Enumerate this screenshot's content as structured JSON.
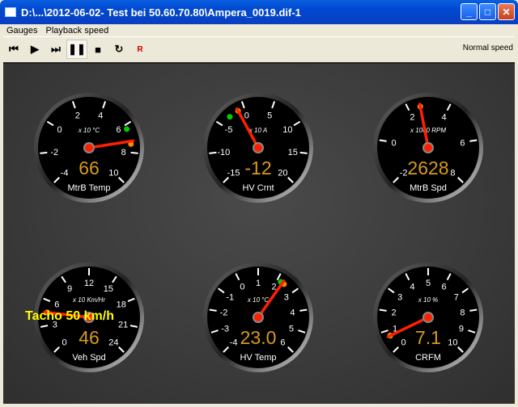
{
  "window": {
    "title": "D:\\...\\2012-06-02- Test bei 50.60.70.80\\Ampera_0019.dif-1"
  },
  "menu": [
    "Gauges",
    "Playback speed"
  ],
  "toolbar": {
    "buttons": [
      {
        "name": "skip-to-start-button",
        "glyph": "⏮"
      },
      {
        "name": "play-button",
        "glyph": "▶"
      },
      {
        "name": "skip-to-end-button",
        "glyph": "⏭"
      },
      {
        "name": "pause-button",
        "glyph": "❚❚",
        "pressed": true
      },
      {
        "name": "stop-button",
        "glyph": "■"
      },
      {
        "name": "loop-button",
        "glyph": "↻"
      },
      {
        "name": "reverse-button",
        "glyph": "R"
      }
    ],
    "speed_label": "Normal speed"
  },
  "colors": {
    "needle": "#ff2000",
    "readout": "#d89a1c",
    "min_marker": "#00cc00",
    "max_marker": "#ff8800",
    "status": "#ffff00"
  },
  "gauges": [
    {
      "label": "MtrB Temp",
      "unit": "x 10 °C",
      "readout": "66",
      "scale": [
        "-4",
        "-2",
        "0",
        "2",
        "4",
        "6",
        "8",
        "10"
      ],
      "needle": 7.2,
      "min_marker": 6.3,
      "max_marker": 7.4
    },
    {
      "label": "HV Crnt",
      "unit": "x 10 A",
      "readout": "-12",
      "scale": [
        "-15",
        "-10",
        "-5",
        "0",
        "5",
        "10",
        "15",
        "20"
      ],
      "needle": -1.2,
      "min_marker": -3,
      "max_marker": -1.2
    },
    {
      "label": "MtrB Spd",
      "unit": "x 1000 RPM",
      "readout": "2628",
      "scale": [
        "-2",
        "0",
        "2",
        "4",
        "6",
        "8"
      ],
      "needle": 2.6,
      "min_marker": 2.6,
      "max_marker": 2.6
    },
    {
      "label": "Veh Spd",
      "unit": "x 10 Km/Hr",
      "readout": "46",
      "scale": [
        "0",
        "3",
        "6",
        "9",
        "12",
        "15",
        "18",
        "21",
        "24"
      ],
      "needle": 4.6,
      "min_marker": 4.6,
      "max_marker": 4.6
    },
    {
      "label": "HV Temp",
      "unit": "x 10 °C",
      "readout": "23.0",
      "scale": [
        "-4",
        "-3",
        "-2",
        "-1",
        "0",
        "1",
        "2",
        "3",
        "4",
        "5",
        "6"
      ],
      "needle": 2.3,
      "min_marker": 2.2,
      "max_marker": 2.4
    },
    {
      "label": "CRFM",
      "unit": "x 10 %",
      "readout": "7.1",
      "scale": [
        "0",
        "1",
        "2",
        "3",
        "4",
        "5",
        "6",
        "7",
        "8",
        "9",
        "10"
      ],
      "needle": 0.71,
      "min_marker": 0.7,
      "max_marker": 0.72
    }
  ],
  "status": "Tacho 50 km/h"
}
